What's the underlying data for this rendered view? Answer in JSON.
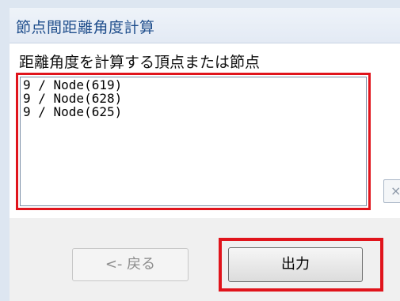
{
  "window": {
    "title": "節点間距離角度計算"
  },
  "list": {
    "label": "距離角度を計算する頂点または節点",
    "items": [
      "9 / Node(619)",
      "9 / Node(628)",
      "9 / Node(625)"
    ]
  },
  "side_button": {
    "glyph": "×"
  },
  "footer": {
    "back_label": "<- 戻る",
    "output_label": "出力"
  },
  "colors": {
    "highlight": "#e0141c",
    "title_text": "#1f4e8c"
  }
}
